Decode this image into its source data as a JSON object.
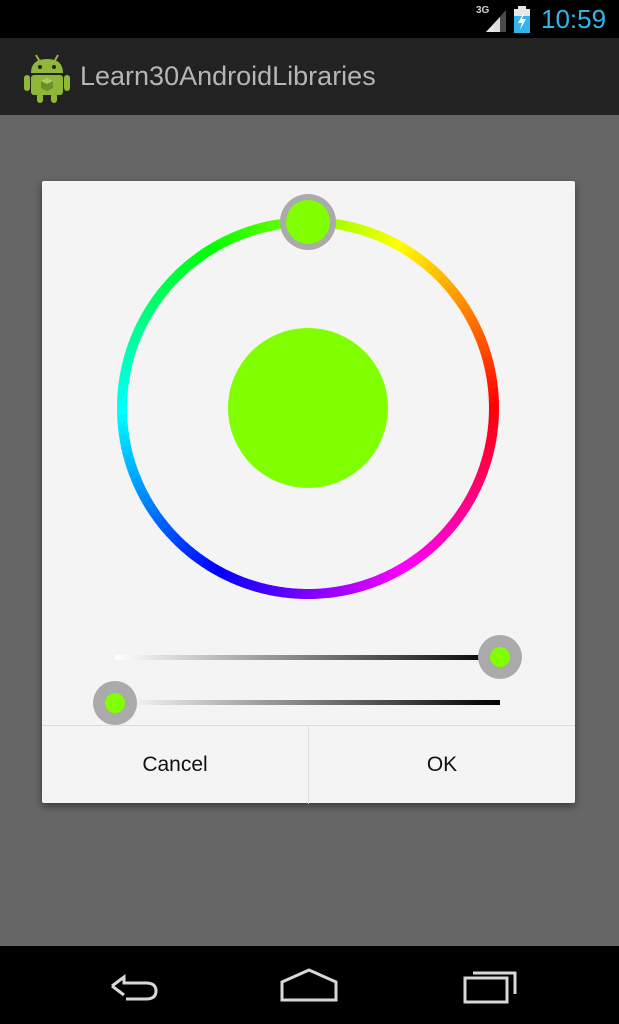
{
  "status_bar": {
    "network": "3G",
    "time": "10:59"
  },
  "action_bar": {
    "title": "Learn30AndroidLibraries",
    "icon": "android-icon"
  },
  "dialog": {
    "selected_color": "#80ff00",
    "picker_thumb_color": "#80ff00",
    "saturation_level": 1.0,
    "value_level": 0.0,
    "cancel_label": "Cancel",
    "ok_label": "OK"
  },
  "nav_bar": {
    "back_icon": "back-icon",
    "home_icon": "home-icon",
    "recents_icon": "recents-icon"
  },
  "colors": {
    "status_time": "#33b5e5",
    "dim_background": "#666666",
    "dialog_background": "#f4f4f4"
  }
}
